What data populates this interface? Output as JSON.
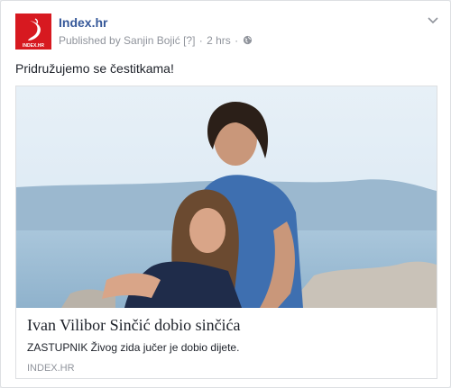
{
  "post": {
    "page_name": "Index.hr",
    "published_by": "Published by Sanjin Bojić",
    "help_marker": "[?]",
    "separator": "·",
    "time": "2 hrs",
    "separator2": "·",
    "privacy_icon": "globe-icon",
    "menu_icon": "chevron-down-icon",
    "text": "Pridružujemo se čestitkama!",
    "avatar_logo_text": "INDEX.HR"
  },
  "link": {
    "title": "Ivan Vilibor Sinčić dobio sinčića",
    "description": "ZASTUPNIK Živog zida jučer je dobio dijete.",
    "domain": "INDEX.HR"
  },
  "colors": {
    "brand_red": "#d71920",
    "link_blue": "#365899",
    "meta_gray": "#90949c"
  }
}
